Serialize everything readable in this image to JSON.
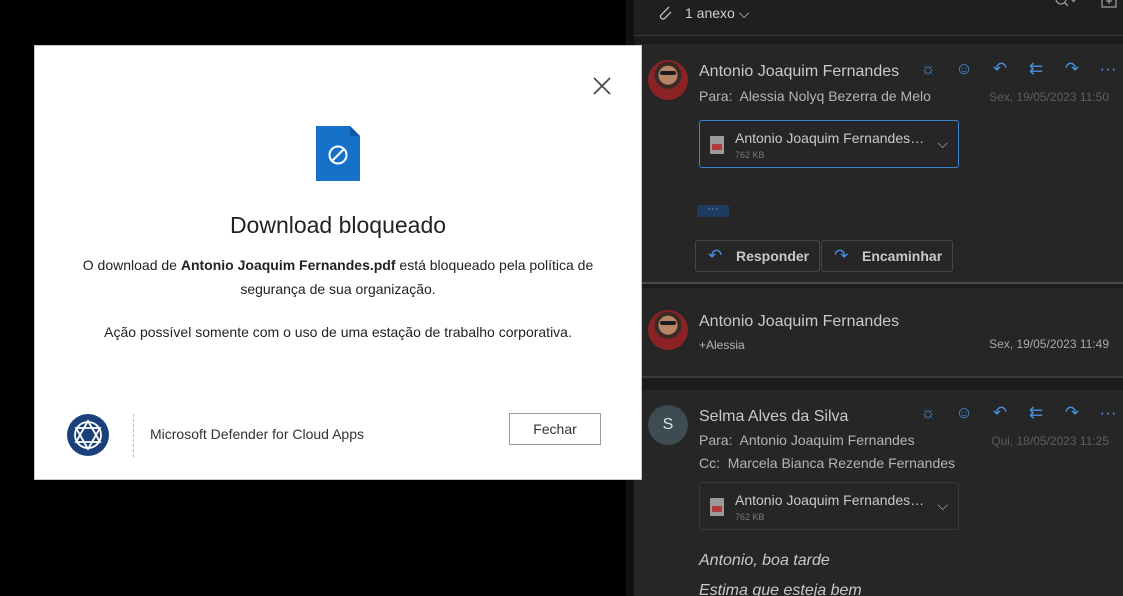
{
  "dialog": {
    "title": "Download bloqueado",
    "message_prefix": "O download de ",
    "file_name": "Antonio Joaquim Fernandes.pdf",
    "message_suffix": " está bloqueado pela política de segurança de sua organização.",
    "note": "Ação possível somente com o uso de uma estação de trabalho corporativa.",
    "brand": "Microsoft Defender for Cloud Apps",
    "close_button": "Fechar",
    "icons": {
      "close": "close-icon",
      "file": "blocked-file-icon",
      "logo": "defender-logo-icon"
    },
    "colors": {
      "file_icon": "#1671c9",
      "logo": "#1b3f7a"
    }
  },
  "mail": {
    "attachments_label": "1 anexo",
    "messages": [
      {
        "sender": "Antonio Joaquim Fernandes",
        "to_label": "Para:",
        "to": "Alessia Nolyq Bezerra de Melo",
        "date": "Sex, 19/05/2023 11:50",
        "attachment_name": "Antonio Joaquim Fernandes....",
        "attachment_size": "762 KB",
        "more": "···",
        "reply": "Responder",
        "forward": "Encaminhar"
      },
      {
        "sender": "Antonio Joaquim Fernandes",
        "to": "+Alessia",
        "date": "Sex, 19/05/2023 11:49"
      },
      {
        "initial": "S",
        "sender": "Selma Alves da Silva",
        "to_label": "Para:",
        "to": "Antonio Joaquim Fernandes",
        "cc_label": "Cc:",
        "cc": "Marcela Bianca Rezende Fernandes",
        "date": "Qui, 18/05/2023 11:25",
        "attachment_name": "Antonio Joaquim Fernandes....",
        "attachment_size": "762 KB",
        "body_line1": "Antonio, boa tarde",
        "body_line2": "Estima que esteja bem"
      }
    ],
    "action_icons": [
      "sun-icon",
      "emoji-icon",
      "reply-icon",
      "reply-all-icon",
      "forward-icon",
      "more-icon"
    ],
    "accent": "#4a8fe0"
  }
}
